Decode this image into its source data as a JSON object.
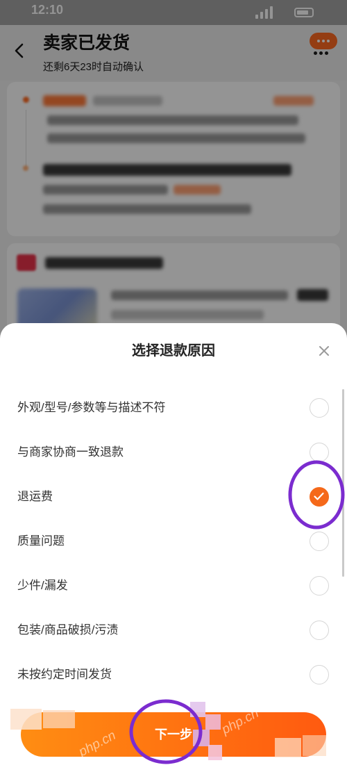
{
  "status_bar": {
    "time": "12:10"
  },
  "header": {
    "back_icon": "chevron-left-icon",
    "title": "卖家已发货",
    "subtitle": "还剩6天23时自动确认",
    "chat_icon": "chat-bubble-icon",
    "more_icon": "more-dots-icon"
  },
  "sheet": {
    "title": "选择退款原因",
    "close_icon": "close-icon",
    "reasons": [
      {
        "label": "外观/型号/参数等与描述不符",
        "selected": false
      },
      {
        "label": "与商家协商一致退款",
        "selected": false
      },
      {
        "label": "退运费",
        "selected": true
      },
      {
        "label": "质量问题",
        "selected": false
      },
      {
        "label": "少件/漏发",
        "selected": false
      },
      {
        "label": "包装/商品破损/污渍",
        "selected": false
      },
      {
        "label": "未按约定时间发货",
        "selected": false
      }
    ],
    "check_icon": "checkmark-icon",
    "next_label": "下一步"
  },
  "watermark": {
    "text": "php.cn"
  },
  "colors": {
    "accent": "#f5691a",
    "button_start": "#ff8d12",
    "button_end": "#ff5a10",
    "annotation": "#7b2ccf",
    "backdrop": "rgba(0,0,0,0.42)"
  }
}
